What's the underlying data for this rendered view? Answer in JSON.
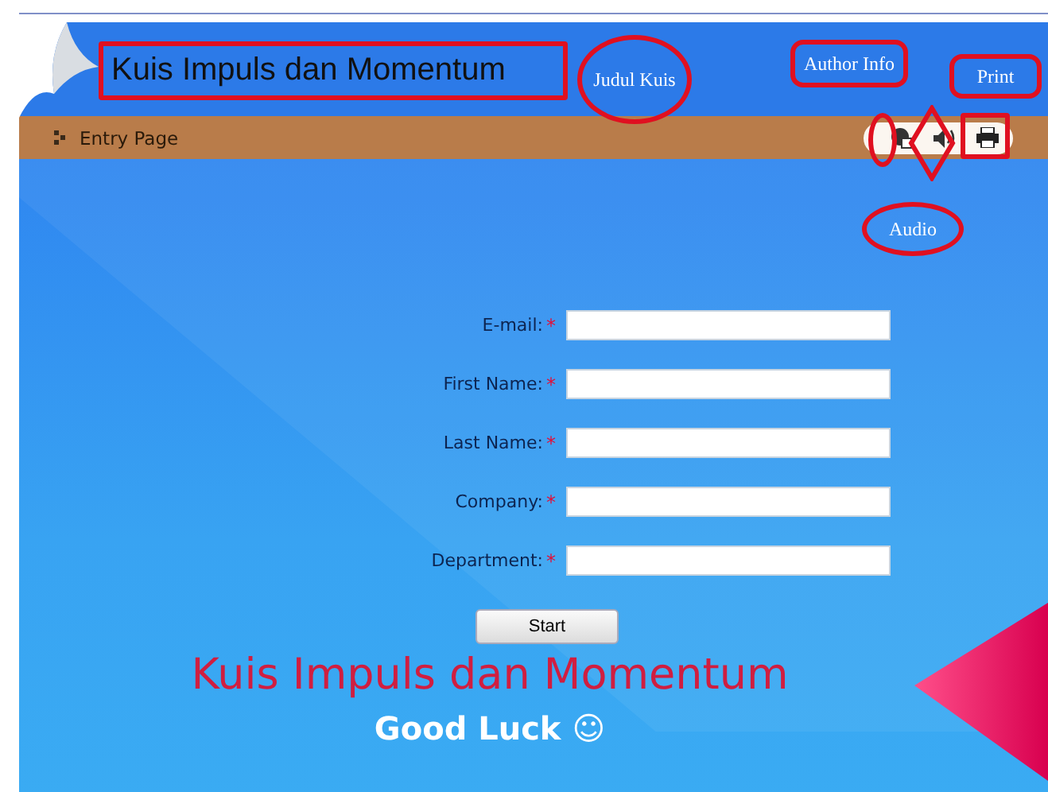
{
  "header": {
    "title": "Kuis Impuls dan Momentum"
  },
  "nav_bar": {
    "breadcrumb": "Entry Page"
  },
  "form": {
    "fields": [
      {
        "label": "E-mail:",
        "required_mark": "*"
      },
      {
        "label": "First Name:",
        "required_mark": "*"
      },
      {
        "label": "Last Name:",
        "required_mark": "*"
      },
      {
        "label": "Company:",
        "required_mark": "*"
      },
      {
        "label": "Department:",
        "required_mark": "*"
      }
    ],
    "submit": "Start"
  },
  "banner": {
    "title": "Kuis Impuls dan Momentum",
    "subtitle": "Good Luck ☺"
  },
  "annotations": [
    {
      "text": "Judul Kuis",
      "kind": "ellipse"
    },
    {
      "text": "Author Info",
      "kind": "box"
    },
    {
      "text": "Print",
      "kind": "box"
    },
    {
      "text": "Audio",
      "kind": "ellipse"
    }
  ]
}
